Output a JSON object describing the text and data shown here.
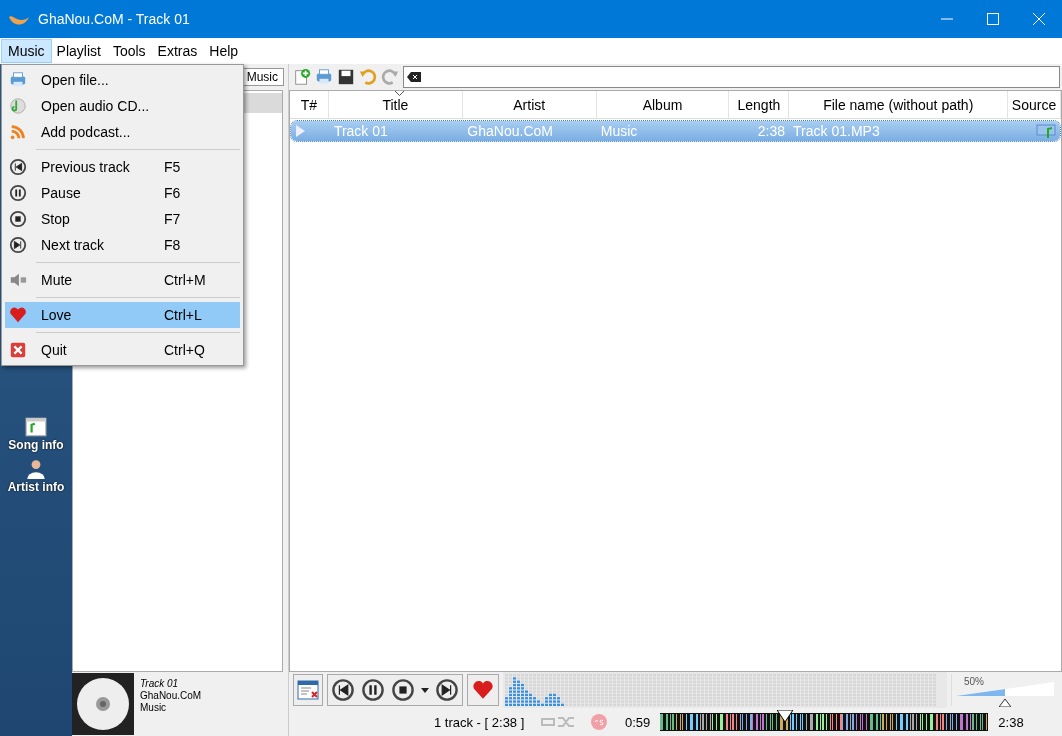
{
  "window": {
    "title": "GhaNou.CoM - Track 01"
  },
  "menu_bar": [
    {
      "label": "Music",
      "selected": true
    },
    {
      "label": "Playlist",
      "selected": false
    },
    {
      "label": "Tools",
      "selected": false
    },
    {
      "label": "Extras",
      "selected": false
    },
    {
      "label": "Help",
      "selected": false
    }
  ],
  "music_menu": [
    {
      "kind": "item",
      "label": "Open file...",
      "selected": false
    },
    {
      "kind": "item",
      "label": "Open audio CD...",
      "selected": false
    },
    {
      "kind": "item",
      "label": "Add podcast...",
      "selected": false
    },
    {
      "kind": "separator"
    },
    {
      "kind": "item",
      "label": "Previous track",
      "shortcut": "F5",
      "selected": false
    },
    {
      "kind": "item",
      "label": "Pause",
      "shortcut": "F6",
      "selected": false
    },
    {
      "kind": "item",
      "label": "Stop",
      "shortcut": "F7",
      "selected": false
    },
    {
      "kind": "item",
      "label": "Next track",
      "shortcut": "F8",
      "selected": false
    },
    {
      "kind": "separator"
    },
    {
      "kind": "item",
      "label": "Mute",
      "shortcut": "Ctrl+M",
      "selected": false
    },
    {
      "kind": "separator"
    },
    {
      "kind": "item",
      "label": "Love",
      "shortcut": "Ctrl+L",
      "selected": true
    },
    {
      "kind": "separator"
    },
    {
      "kind": "item",
      "label": "Quit",
      "shortcut": "Ctrl+Q",
      "selected": false
    }
  ],
  "sidebar": [
    {
      "label": "Song info"
    },
    {
      "label": "Artist info"
    }
  ],
  "left_panel": {
    "tab": "Music"
  },
  "table": {
    "columns": [
      {
        "label": "T#",
        "sorted": false
      },
      {
        "label": "Title",
        "sorted": true
      },
      {
        "label": "Artist",
        "sorted": false
      },
      {
        "label": "Album",
        "sorted": false
      },
      {
        "label": "Length",
        "sorted": false
      },
      {
        "label": "File name (without path)",
        "sorted": false
      },
      {
        "label": "Source",
        "sorted": false
      }
    ],
    "rows": [
      {
        "selected": true,
        "playing": true,
        "cells": [
          "",
          "Track 01",
          "GhaNou.CoM",
          "Music",
          "2:38",
          "Track 01.MP3",
          ""
        ]
      }
    ]
  },
  "now_playing": {
    "title": "Track 01",
    "artist": "GhaNou.CoM",
    "album": "Music"
  },
  "player": {
    "loved": true
  },
  "volume": {
    "reading": "50%",
    "level": 0.5
  },
  "status": {
    "count": "1 track - [ 2:38 ]",
    "elapsed": "0:59",
    "total": "2:38"
  },
  "seek_bar": {
    "level": 0.38
  }
}
